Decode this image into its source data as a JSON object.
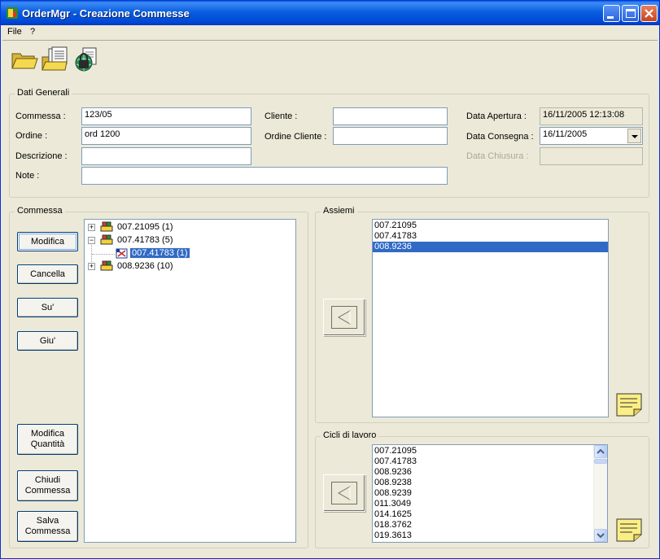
{
  "window": {
    "title": "OrderMgr - Creazione Commesse"
  },
  "menu": [
    "File",
    "?"
  ],
  "toolbar": {
    "buttons": [
      {
        "icon": "open-folder-icon"
      },
      {
        "icon": "documents-icon"
      },
      {
        "icon": "lock-globe-icon"
      }
    ]
  },
  "dati_generali": {
    "legend": "Dati Generali",
    "commessa_label": "Commessa :",
    "commessa_value": "123/05",
    "ordine_label": "Ordine :",
    "ordine_value": "ord 1200",
    "descrizione_label": "Descrizione :",
    "descrizione_value": "",
    "note_label": "Note :",
    "note_value": "",
    "cliente_label": "Cliente :",
    "cliente_value": "",
    "ordine_cliente_label": "Ordine Cliente :",
    "ordine_cliente_value": "",
    "data_apertura_label": "Data Apertura :",
    "data_apertura_value": "16/11/2005 12:13:08",
    "data_consegna_label": "Data Consegna :",
    "data_consegna_value": "16/11/2005",
    "data_chiusura_label": "Data Chiusura :",
    "data_chiusura_value": ""
  },
  "commessa": {
    "legend": "Commessa",
    "buttons": {
      "modifica": "Modifica",
      "cancella": "Cancella",
      "su": "Su'",
      "giu": "Giu'",
      "modifica_quantita": "Modifica Quantità",
      "chiudi_commessa": "Chiudi Commessa",
      "salva_commessa": "Salva Commessa"
    },
    "tree": [
      {
        "label": "007.21095 (1)",
        "expander": "+",
        "level": 0
      },
      {
        "label": "007.41783 (5)",
        "expander": "−",
        "level": 0
      },
      {
        "label": "007.41783 (1)",
        "expander": "",
        "level": 1,
        "selected": true
      },
      {
        "label": "008.9236 (10)",
        "expander": "+",
        "level": 0
      }
    ]
  },
  "assiemi": {
    "legend": "Assiemi",
    "items": [
      "007.21095",
      "007.41783",
      "008.9236"
    ],
    "selected_index": 2
  },
  "cicli": {
    "legend": "Cicli di lavoro",
    "items": [
      "007.21095",
      "007.41783",
      "008.9236",
      "008.9238",
      "008.9239",
      "011.3049",
      "014.1625",
      "018.3762",
      "019.3613"
    ]
  },
  "colors": {
    "title_bar": "#0a5fe0",
    "selection": "#316ac5",
    "window_bg": "#ece9d8"
  }
}
